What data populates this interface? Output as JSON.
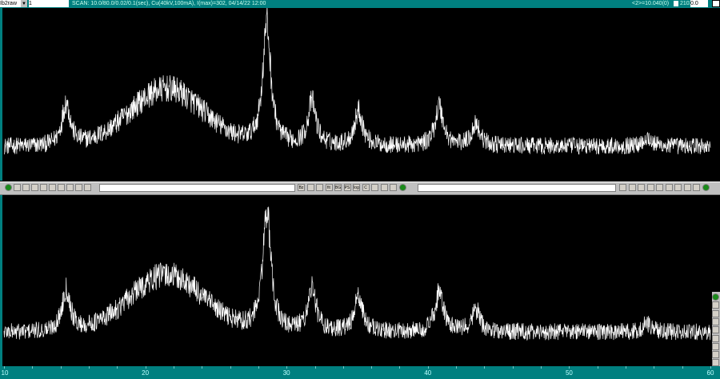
{
  "topbar": {
    "scan_type": "Ib2raw",
    "file_field": "1",
    "scan_info": "SCAN: 10.0/80.0/0.02/0.1(sec), Cu(40kV,100mA), I(max)=302, 04/14/22 12:00",
    "cursor_position": "<2>=10.040(0)",
    "count": "2103",
    "value_field": "0.0"
  },
  "toolbar": {
    "left_buttons": [
      "help-button",
      "settings-button",
      "b3",
      "b4",
      "b5",
      "b6",
      "b7",
      "b8",
      "b9",
      "b10"
    ],
    "middle_buttons": [
      "Bz",
      "zoom",
      "peak",
      "fit",
      "BG",
      "PS",
      "log",
      "C",
      "b",
      "c",
      "view",
      "help"
    ],
    "right_buttons": [
      "r1",
      "r2",
      "r3",
      "r4",
      "r5",
      "r6",
      "r7",
      "r8",
      "r9",
      "help"
    ],
    "input_value": "",
    "dropdown_value": ""
  },
  "vertical_toolbar": [
    "help",
    "expand-h",
    "shrink-v",
    "b4",
    "b5",
    "b6",
    "expand",
    "shrink",
    "stop"
  ],
  "colors": {
    "accent": "#008080",
    "trace": "#ffffff",
    "background": "#000000",
    "toolbar": "#c0c0c0"
  },
  "chart_data": {
    "type": "line",
    "xlabel": "",
    "ylabel": "",
    "xlim": [
      10,
      60
    ],
    "x_ticks": [
      "10",
      "20",
      "30",
      "40",
      "50",
      "60"
    ],
    "grid": false,
    "baseline_relative": 20,
    "amorphous_hump": {
      "center": 21.5,
      "width": 2.6,
      "height": 33
    },
    "peaks": [
      {
        "two_theta": 14.4,
        "height": 25
      },
      {
        "two_theta": 28.6,
        "height": 70
      },
      {
        "two_theta": 31.8,
        "height": 25
      },
      {
        "two_theta": 35.1,
        "height": 20
      },
      {
        "two_theta": 40.8,
        "height": 23
      },
      {
        "two_theta": 43.4,
        "height": 13
      },
      {
        "two_theta": 55.5,
        "height": 5
      }
    ],
    "panels": [
      "top",
      "bottom"
    ]
  }
}
